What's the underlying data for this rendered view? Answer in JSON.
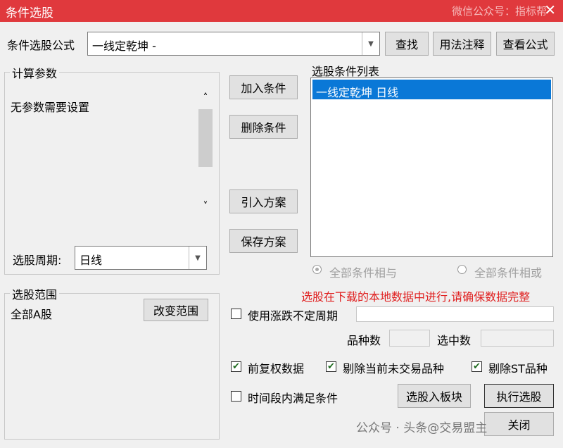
{
  "window": {
    "title": "条件选股",
    "watermark": "微信公众号：指标帮",
    "close_icon": "close-icon"
  },
  "formula_row": {
    "label": "条件选股公式",
    "value": "一线定乾坤  -",
    "find_button": "查找",
    "usage_button": "用法注释",
    "view_button": "查看公式"
  },
  "params": {
    "group_label": "计算参数",
    "message": "无参数需要设置",
    "period_label": "选股周期:",
    "period_value": "日线"
  },
  "actions": {
    "add": "加入条件",
    "delete": "删除条件",
    "import_plan": "引入方案",
    "save_plan": "保存方案"
  },
  "conditions": {
    "label": "选股条件列表",
    "items": [
      {
        "text": "一线定乾坤  日线",
        "selected": true
      }
    ]
  },
  "logic": {
    "and_label": "全部条件相与",
    "or_label": "全部条件相或",
    "selected": "and"
  },
  "range": {
    "group_label": "选股范围",
    "value": "全部A股",
    "change_button": "改变范围"
  },
  "warning": {
    "text": "选股在下载的本地数据中进行,请确保数据完整",
    "color": "#e02020"
  },
  "indefinite": {
    "label": "使用涨跌不定周期",
    "checked": false
  },
  "counts": {
    "variety_label": "品种数",
    "variety_value": "",
    "selected_label": "选中数",
    "selected_value": ""
  },
  "options": [
    {
      "label": "前复权数据",
      "checked": true
    },
    {
      "label": "剔除当前未交易品种",
      "checked": true
    },
    {
      "label": "剔除ST品种",
      "checked": true
    }
  ],
  "time_condition": {
    "label": "时间段内满足条件",
    "checked": false
  },
  "bottom_buttons": {
    "to_block": "选股入板块",
    "execute": "执行选股",
    "close": "关闭"
  },
  "footer_watermark": "公众号 · 头条@交易盟主"
}
